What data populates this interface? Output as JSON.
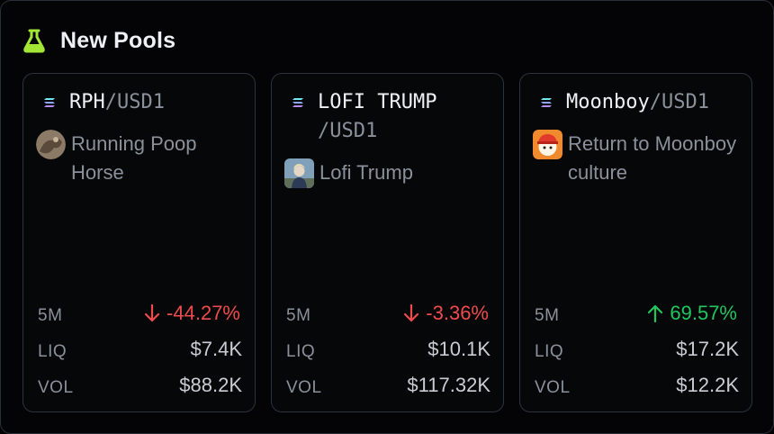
{
  "header": {
    "title": "New Pools",
    "icon": "flask-icon",
    "accent": "#a3e635"
  },
  "colors": {
    "down": "#ef4b4b",
    "up": "#22c55e"
  },
  "pools": [
    {
      "symbol": "RPH",
      "quote": "/USD1",
      "chain_icon": "solana-icon",
      "name": "Running Poop Horse",
      "stats": {
        "change_label": "5M",
        "change": "-44.27%",
        "direction": "down",
        "liq_label": "LIQ",
        "liq": "$7.4K",
        "vol_label": "VOL",
        "vol": "$88.2K"
      }
    },
    {
      "symbol": "LOFI TRUMP",
      "quote": "/USD1",
      "chain_icon": "solana-icon",
      "name": "Lofi Trump",
      "stats": {
        "change_label": "5M",
        "change": "-3.36%",
        "direction": "down",
        "liq_label": "LIQ",
        "liq": "$10.1K",
        "vol_label": "VOL",
        "vol": "$117.32K"
      }
    },
    {
      "symbol": "Moonboy",
      "quote": "/USD1",
      "chain_icon": "solana-icon",
      "name": "Return to Moonboy culture",
      "stats": {
        "change_label": "5M",
        "change": "69.57%",
        "direction": "up",
        "liq_label": "LIQ",
        "liq": "$17.2K",
        "vol_label": "VOL",
        "vol": "$12.2K"
      }
    }
  ]
}
